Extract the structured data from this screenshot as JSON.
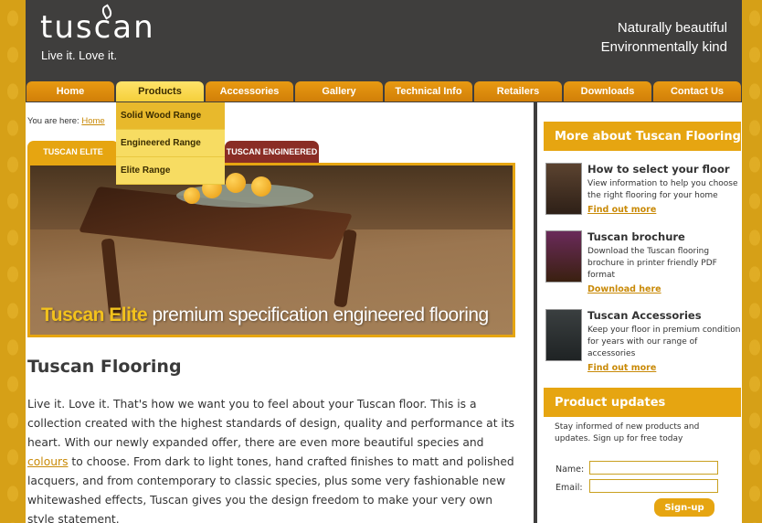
{
  "header": {
    "logo": "tuscan",
    "tagline": "Live it. Love it.",
    "slogan_line1": "Naturally beautiful",
    "slogan_line2": "Environmentally kind"
  },
  "nav": {
    "items": [
      {
        "label": "Home"
      },
      {
        "label": "Products"
      },
      {
        "label": "Accessories"
      },
      {
        "label": "Gallery"
      },
      {
        "label": "Technical Info"
      },
      {
        "label": "Retailers"
      },
      {
        "label": "Downloads"
      },
      {
        "label": "Contact Us"
      }
    ],
    "active": "Products"
  },
  "dropdown": {
    "items": [
      {
        "label": "Solid Wood Range"
      },
      {
        "label": "Engineered Range"
      },
      {
        "label": "Elite Range"
      }
    ]
  },
  "breadcrumb": {
    "prefix": "You are here:",
    "link": "Home"
  },
  "tabs": [
    {
      "label": "TUSCAN ELITE"
    },
    {
      "label": "TUSCAN ENGINEERED"
    }
  ],
  "hero": {
    "caption_bold": "Tuscan Elite",
    "caption_rest": "premium specification engineered flooring"
  },
  "main": {
    "title": "Tuscan Flooring",
    "intro_before": "Live it. Love it. That's how we want you to feel about your Tuscan floor. This is a collection created with the highest standards of design, quality and performance at its heart. With our newly expanded offer, there are even more beautiful species and ",
    "intro_link": "colours",
    "intro_after": " to choose. From dark to light tones, hand crafted finishes to matt and polished lacquers, and from contemporary to classic species, plus some very fashionable new whitewashed effects, Tuscan gives you the design freedom to make your very own style statement."
  },
  "sidebar": {
    "more_heading": "More about Tuscan Flooring",
    "promos": [
      {
        "title": "How to select your floor",
        "desc": "View information to help you choose the right flooring for your home",
        "link": "Find out more"
      },
      {
        "title": "Tuscan brochure",
        "desc": "Download the Tuscan flooring brochure in printer friendly PDF format",
        "link": "Download here"
      },
      {
        "title": "Tuscan Accessories",
        "desc": "Keep your floor in premium condition for years with our range of accessories",
        "link": "Find out more"
      }
    ],
    "updates_heading": "Product updates",
    "updates_text": "Stay informed of new products and updates. Sign up for free today",
    "name_label": "Name:",
    "email_label": "Email:",
    "name_value": "",
    "email_value": "",
    "signup_label": "Sign-up"
  },
  "colors": {
    "brand_orange": "#e6a511",
    "header_dark": "#3f3e3d",
    "link": "#c98a08",
    "engineered_tab": "#8a2d25"
  }
}
